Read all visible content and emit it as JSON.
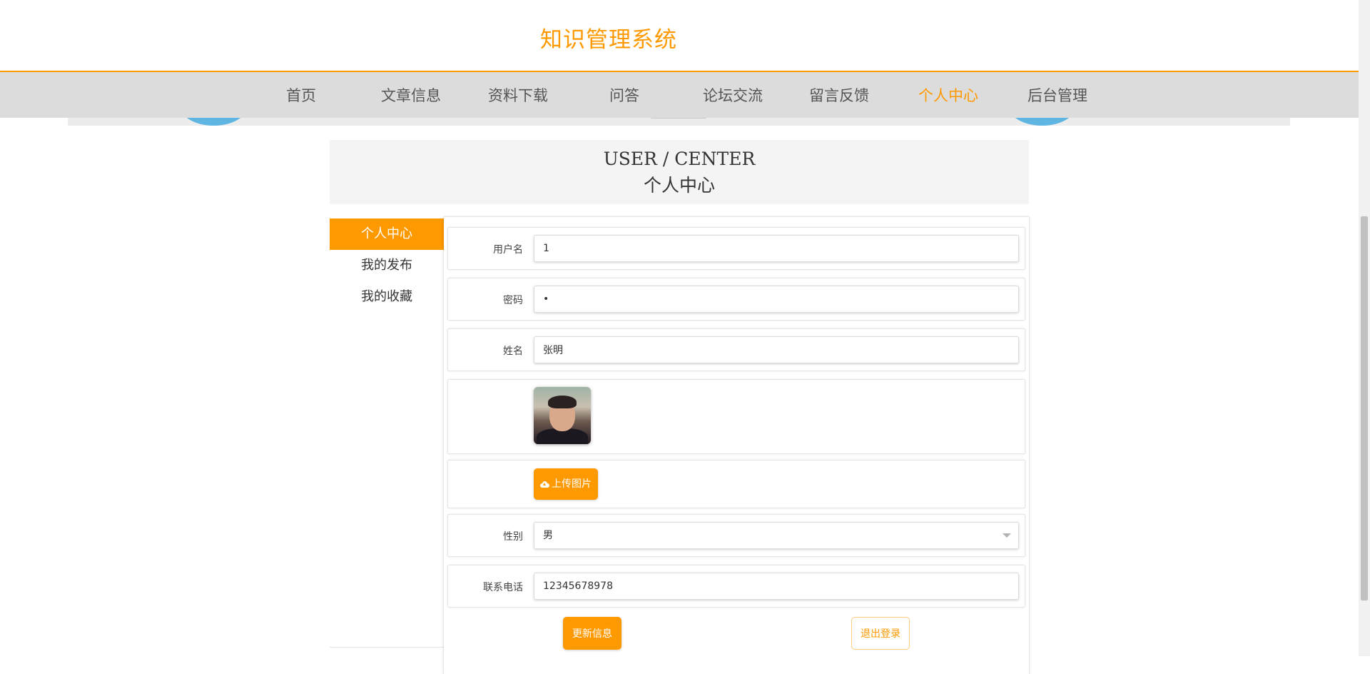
{
  "site": {
    "title": "知识管理系统"
  },
  "nav": {
    "items": [
      {
        "label": "首页"
      },
      {
        "label": "文章信息"
      },
      {
        "label": "资料下载"
      },
      {
        "label": "问答"
      },
      {
        "label": "论坛交流"
      },
      {
        "label": "留言反馈"
      },
      {
        "label": "个人中心",
        "active": true
      },
      {
        "label": "后台管理"
      }
    ]
  },
  "page_header": {
    "en": "USER / CENTER",
    "cn": "个人中心"
  },
  "side_menu": {
    "items": [
      {
        "label": "个人中心",
        "active": true
      },
      {
        "label": "我的发布"
      },
      {
        "label": "我的收藏"
      }
    ]
  },
  "form": {
    "username": {
      "label": "用户名",
      "value": "1"
    },
    "password": {
      "label": "密码",
      "value": "•"
    },
    "name": {
      "label": "姓名",
      "value": "张明"
    },
    "upload_label": "上传图片",
    "gender": {
      "label": "性别",
      "value": "男"
    },
    "phone": {
      "label": "联系电话",
      "value": "12345678978"
    },
    "update_label": "更新信息",
    "logout_label": "退出登录"
  },
  "colors": {
    "accent": "#ff9900",
    "nav_bg": "#dcdcdc",
    "header_block_bg": "#f4f4f4"
  },
  "icons": {
    "upload": "cloud-upload-icon",
    "select": "chevron-down-icon"
  }
}
